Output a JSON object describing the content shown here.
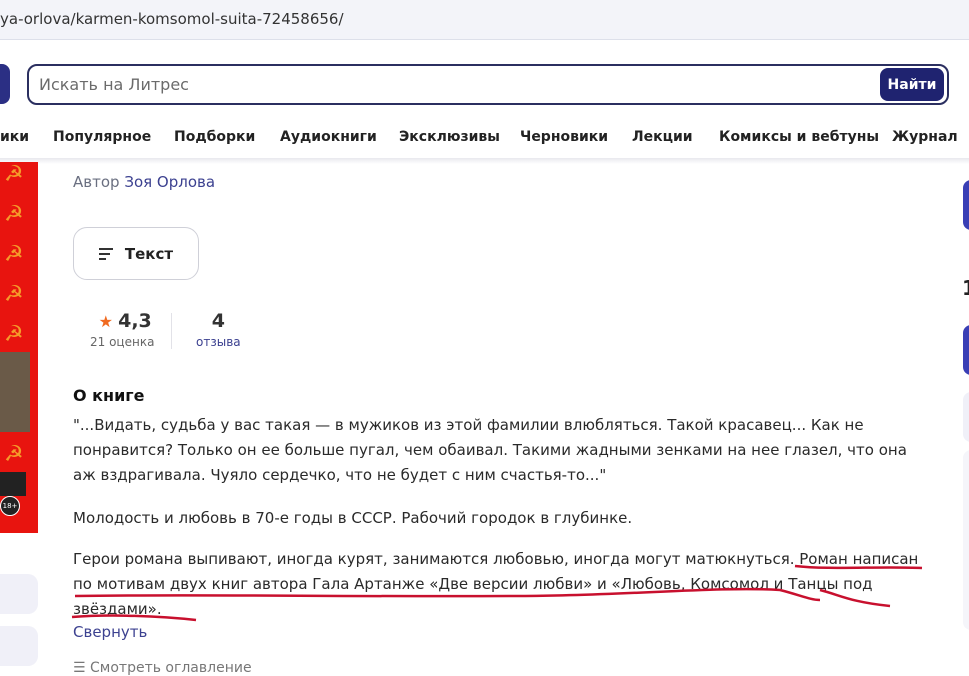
{
  "browser": {
    "url": "ya-orlova/karmen-komsomol-suita-72458656/"
  },
  "search": {
    "placeholder": "Искать на Литрес",
    "button": "Найти"
  },
  "nav": [
    "ики",
    "Популярное",
    "Подборки",
    "Аудиокниги",
    "Эксклюзивы",
    "Черновики",
    "Лекции",
    "Комиксы и вебтуны",
    "Журнал"
  ],
  "book": {
    "author_label": "Автор",
    "author": "Зоя Орлова",
    "format_button": "Текст",
    "rating": "4,3",
    "rating_count": "21 оценка",
    "reviews_count": "4",
    "reviews_label": "отзыва",
    "age_badge": "18+"
  },
  "about": {
    "title": "О книге",
    "paragraphs": [
      "\"...Видать, судьба у вас такая — в мужиков из этой фамилии влюбляться. Такой красавец... Как не понравится? Только он ее больше пугал, чем обаивал. Такими жадными зенками на нее глазел, что она аж вздрагивала. Чуяло сердечко, что не будет с ним счастья-то...\"",
      "Молодость и любовь в 70-е годы в СССР. Рабочий городок в глубинке.",
      "Герои романа выпивают, иногда курят, занимаются любовью, иногда могут матюкнуться. Роман написан по мотивам двух книг автора Гала Артанже «Две версии любви» и «Любовь, Комсомол и Танцы под звёздами»."
    ],
    "collapse": "Свернуть",
    "toc": "Смотреть оглавление"
  },
  "right": {
    "partial_text": "1"
  },
  "colors": {
    "accent": "#3c4190",
    "button": "#1f2370",
    "cover": "#e8140f",
    "ink": "#c8102e"
  }
}
